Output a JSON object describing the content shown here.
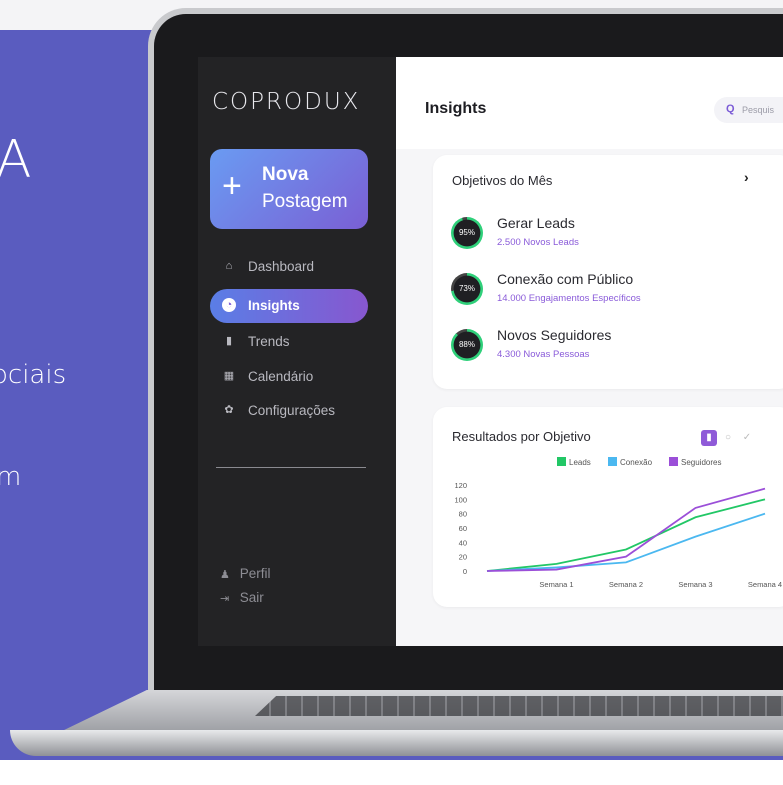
{
  "promo": {
    "line1": "A",
    "line2": "ociais",
    "line3": "m"
  },
  "app": {
    "logo": "COPRODUX",
    "new_post": {
      "icon": "plus-icon",
      "line1": "Nova",
      "line2": "Postagem"
    },
    "nav": [
      {
        "label": "Dashboard",
        "icon": "home-icon",
        "active": false
      },
      {
        "label": "Insights",
        "icon": "insights-icon",
        "active": true
      },
      {
        "label": "Trends",
        "icon": "trends-icon",
        "active": false
      },
      {
        "label": "Calendário",
        "icon": "calendar-icon",
        "active": false
      },
      {
        "label": "Configurações",
        "icon": "gear-icon",
        "active": false
      }
    ],
    "footer": [
      {
        "label": "Perfil",
        "icon": "user-icon"
      },
      {
        "label": "Sair",
        "icon": "logout-icon"
      }
    ]
  },
  "main": {
    "title": "Insights",
    "search_placeholder": "Pesquis"
  },
  "goals": {
    "title": "Objetivos do Mês",
    "items": [
      {
        "title": "Gerar Leads",
        "subtitle": "2.500 Novos Leads",
        "percent": "95%",
        "progress": 0.95
      },
      {
        "title": "Conexão com Público",
        "subtitle": "14.000 Engajamentos Específicos",
        "percent": "73%",
        "progress": 0.73
      },
      {
        "title": "Novos Seguidores",
        "subtitle": "4.300 Novas Pessoas",
        "percent": "88%",
        "progress": 0.88
      }
    ]
  },
  "results": {
    "title": "Resultados por Objetivo"
  },
  "colors": {
    "accent": "#8757cf",
    "sidebar_bg": "#232325",
    "promo_bg": "#5a5cbf",
    "ring": "#2fd07a"
  },
  "chart_data": {
    "type": "line",
    "title": "Resultados por Objetivo",
    "x": [
      "",
      "Semana 1",
      "Semana 2",
      "Semana 3",
      "Semana 4"
    ],
    "ylim": [
      0,
      120
    ],
    "yticks": [
      0,
      20,
      40,
      60,
      80,
      100,
      120
    ],
    "legend_position": "top",
    "grid": false,
    "series": [
      {
        "name": "Leads",
        "color": "#22c766",
        "values": [
          0,
          10,
          30,
          75,
          100
        ]
      },
      {
        "name": "Conexão",
        "color": "#4bb8f0",
        "values": [
          0,
          5,
          12,
          48,
          80
        ]
      },
      {
        "name": "Seguidores",
        "color": "#9b4fd8",
        "values": [
          0,
          2,
          20,
          88,
          115
        ]
      }
    ]
  }
}
